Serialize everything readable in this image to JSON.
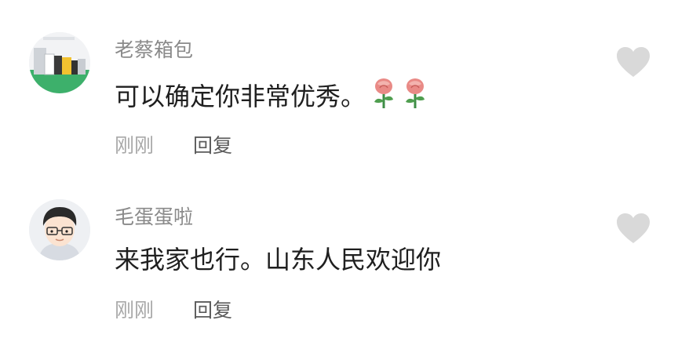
{
  "comments": [
    {
      "username": "老蔡箱包",
      "text": "可以确定你非常优秀。",
      "emoji": "rose-icon",
      "time": "刚刚",
      "reply_label": "回复"
    },
    {
      "username": "毛蛋蛋啦",
      "text": "来我家也行。山东人民欢迎你",
      "time": "刚刚",
      "reply_label": "回复"
    }
  ],
  "colors": {
    "username": "#8a8a8a",
    "content": "#1f1f1f",
    "time": "#a8a8a8",
    "reply": "#5b5b5b",
    "like_icon": "#d9d9d9"
  }
}
